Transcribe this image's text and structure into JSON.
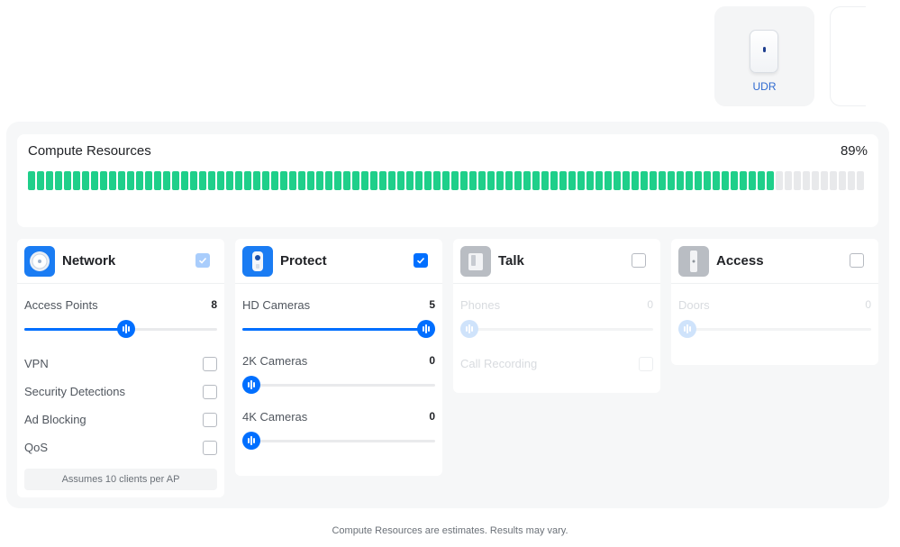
{
  "devices": [
    {
      "label": "UDR",
      "icon": "udr-device-icon"
    }
  ],
  "compute": {
    "title": "Compute Resources",
    "percent_label": "89%",
    "percent": 0.89,
    "segments_total": 93,
    "color_on": "#1fcf8a",
    "color_off": "#e8e9eb"
  },
  "apps": {
    "network": {
      "name": "Network",
      "icon": "network-app-icon",
      "enabled": true,
      "access_points": {
        "label": "Access Points",
        "value": "8",
        "fraction": 0.53
      },
      "options": [
        {
          "label": "VPN",
          "checked": false
        },
        {
          "label": "Security Detections",
          "checked": false
        },
        {
          "label": "Ad Blocking",
          "checked": false
        },
        {
          "label": "QoS",
          "checked": false
        }
      ],
      "note": "Assumes 10 clients per AP"
    },
    "protect": {
      "name": "Protect",
      "icon": "protect-app-icon",
      "enabled": true,
      "sliders": [
        {
          "label": "HD Cameras",
          "value": "5",
          "fraction": 1.0
        },
        {
          "label": "2K Cameras",
          "value": "0",
          "fraction": 0
        },
        {
          "label": "4K Cameras",
          "value": "0",
          "fraction": 0
        }
      ]
    },
    "talk": {
      "name": "Talk",
      "icon": "talk-app-icon",
      "enabled": false,
      "phones": {
        "label": "Phones",
        "value": "0",
        "fraction": 0
      },
      "call_recording": {
        "label": "Call Recording",
        "checked": false
      }
    },
    "access": {
      "name": "Access",
      "icon": "access-app-icon",
      "enabled": false,
      "doors": {
        "label": "Doors",
        "value": "0",
        "fraction": 0
      }
    }
  },
  "footer": "Compute Resources are estimates. Results may vary.",
  "colors": {
    "accent": "#006fff",
    "compute_fill": "#1fcf8a"
  }
}
